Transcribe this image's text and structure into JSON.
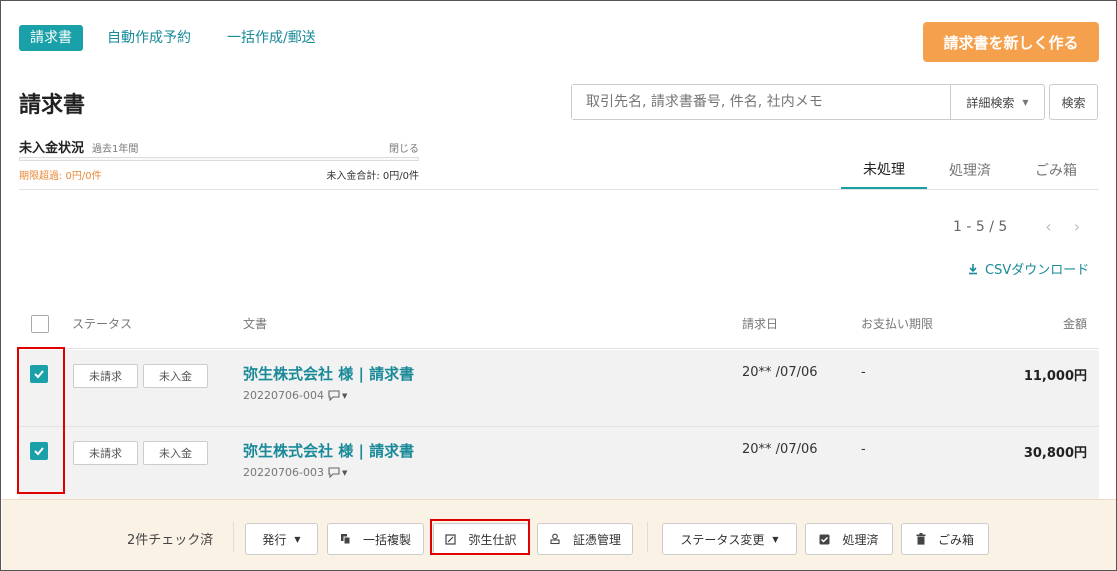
{
  "nav": {
    "items": [
      {
        "label": "請求書",
        "active": true
      },
      {
        "label": "自動作成予約",
        "active": false
      },
      {
        "label": "一括作成/郵送",
        "active": false
      }
    ],
    "create_button": "請求書を新しく作る"
  },
  "page_title": "請求書",
  "search": {
    "placeholder": "取引先名, 請求書番号, 件名, 社内メモ",
    "advanced_label": "詳細検索",
    "button_label": "検索"
  },
  "unpaid_summary": {
    "title": "未入金状況",
    "period": "過去1年間",
    "close_label": "閉じる",
    "overdue": "期限超過: 0円/0件",
    "total": "未入金合計: 0円/0件"
  },
  "tabs": [
    {
      "label": "未処理",
      "active": true
    },
    {
      "label": "処理済",
      "active": false
    },
    {
      "label": "ごみ箱",
      "active": false
    }
  ],
  "pagination": {
    "range": "1 - 5 / 5",
    "prev": "‹",
    "next": "›"
  },
  "csv_label": "CSVダウンロード",
  "table": {
    "headers": {
      "status": "ステータス",
      "document": "文書",
      "date": "請求日",
      "due": "お支払い期限",
      "amount": "金額"
    },
    "rows": [
      {
        "checked": true,
        "status1": "未請求",
        "status2": "未入金",
        "title": "弥生株式会社 様 | 請求書",
        "number": "20220706-004",
        "date": "20** /07/06",
        "due": "-",
        "amount": "11,000円"
      },
      {
        "checked": true,
        "status1": "未請求",
        "status2": "未入金",
        "title": "弥生株式会社 様 | 請求書",
        "number": "20220706-003",
        "date": "20** /07/06",
        "due": "-",
        "amount": "30,800円"
      }
    ]
  },
  "footer": {
    "count": "2件チェック済",
    "issue": "発行",
    "copy": "一括複製",
    "yayoi": "弥生仕訳",
    "voucher": "証憑管理",
    "status_change": "ステータス変更",
    "processed": "処理済",
    "trash": "ごみ箱"
  },
  "colors": {
    "accent": "#1aa0a8",
    "link": "#1a8a99",
    "create": "#f5a04d",
    "overdue": "#e8893a",
    "highlight": "#e00000",
    "footer_bg": "#fbf2e6"
  }
}
